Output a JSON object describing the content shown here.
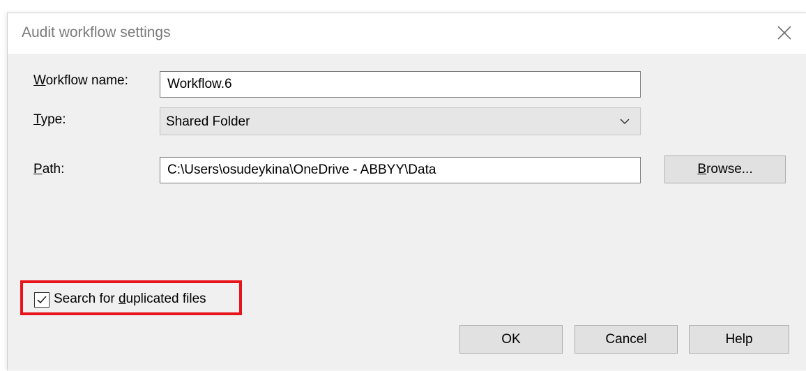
{
  "dialog": {
    "title": "Audit workflow settings"
  },
  "form": {
    "workflow_name": {
      "accel": "W",
      "rest": "orkflow name:",
      "value": "Workflow.6"
    },
    "type": {
      "accel": "T",
      "rest": "ype:",
      "selected": "Shared Folder"
    },
    "path": {
      "accel": "P",
      "rest": "ath:",
      "value": "C:\\Users\\osudeykina\\OneDrive - ABBYY\\Data"
    },
    "browse": {
      "accel": "B",
      "rest": "rowse..."
    }
  },
  "options": {
    "search_duplicates": {
      "prefix": "Search for ",
      "accel": "d",
      "rest": "uplicated files",
      "checked": true
    }
  },
  "footer": {
    "ok_label": "OK",
    "cancel_label": "Cancel",
    "help_label": "Help"
  },
  "colors": {
    "highlight": "#e8141b",
    "dialog_bg": "#f0f0f0"
  },
  "icons": {
    "close": "close-icon",
    "dropdown": "chevron-down-icon",
    "check": "checkmark-icon"
  }
}
